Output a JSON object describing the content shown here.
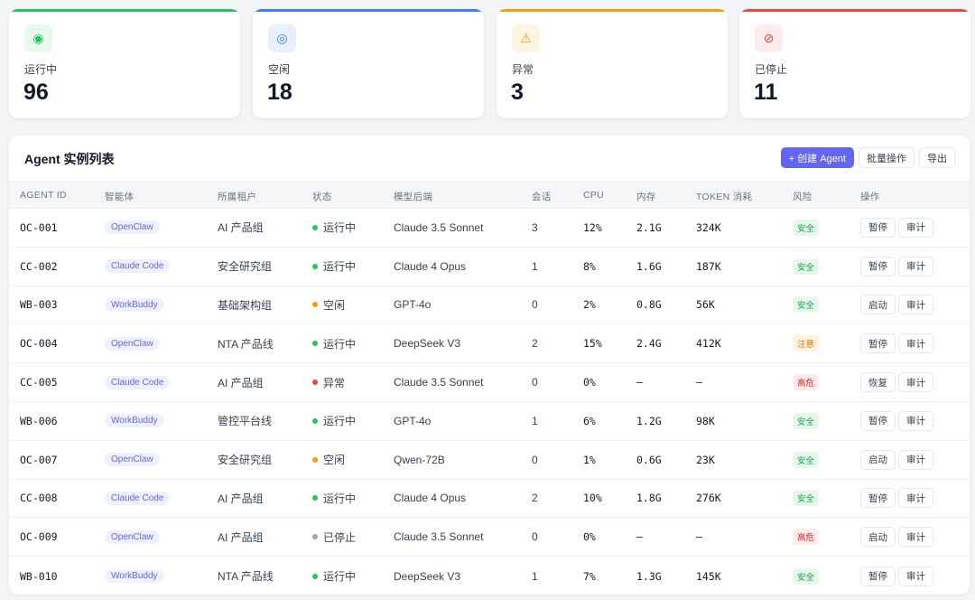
{
  "stats": [
    {
      "label": "运行中",
      "value": "96",
      "icon": "running-icon",
      "glyph": "◉",
      "color": "#22c55e",
      "icon_bg": "#e8f8ee"
    },
    {
      "label": "空闲",
      "value": "18",
      "icon": "idle-icon",
      "glyph": "◎",
      "color": "#3b82f6",
      "icon_bg": "#e9f0fd"
    },
    {
      "label": "异常",
      "value": "3",
      "icon": "warning-icon",
      "glyph": "⚠",
      "color": "#f59e0b",
      "icon_bg": "#fdf5e3"
    },
    {
      "label": "已停止",
      "value": "11",
      "icon": "stopped-icon",
      "glyph": "⊘",
      "color": "#ef4444",
      "icon_bg": "#fdeceb"
    }
  ],
  "panel": {
    "title": "Agent 实例列表",
    "create_label": "+ 创建 Agent",
    "batch_label": "批量操作",
    "export_label": "导出"
  },
  "table": {
    "headers": [
      "AGENT ID",
      "智能体",
      "所属租户",
      "状态",
      "模型后端",
      "会话",
      "CPU",
      "内存",
      "TOKEN 消耗",
      "风险",
      "操作"
    ],
    "rows": [
      {
        "id": "OC-001",
        "agent": "OpenClaw",
        "tenant": "AI 产品组",
        "status": "运行中",
        "status_color": "#22c55e",
        "model": "Claude 3.5 Sonnet",
        "sessions": "3",
        "cpu": "12%",
        "mem": "2.1G",
        "tokens": "324K",
        "risk": "安全",
        "action": "暂停",
        "audit": "审计"
      },
      {
        "id": "CC-002",
        "agent": "Claude Code",
        "tenant": "安全研究组",
        "status": "运行中",
        "status_color": "#22c55e",
        "model": "Claude 4 Opus",
        "sessions": "1",
        "cpu": "8%",
        "mem": "1.6G",
        "tokens": "187K",
        "risk": "安全",
        "action": "暂停",
        "audit": "审计"
      },
      {
        "id": "WB-003",
        "agent": "WorkBuddy",
        "tenant": "基础架构组",
        "status": "空闲",
        "status_color": "#f59e0b",
        "model": "GPT-4o",
        "sessions": "0",
        "cpu": "2%",
        "mem": "0.8G",
        "tokens": "56K",
        "risk": "安全",
        "action": "启动",
        "audit": "审计"
      },
      {
        "id": "OC-004",
        "agent": "OpenClaw",
        "tenant": "NTA 产品线",
        "status": "运行中",
        "status_color": "#22c55e",
        "model": "DeepSeek V3",
        "sessions": "2",
        "cpu": "15%",
        "mem": "2.4G",
        "tokens": "412K",
        "risk": "注意",
        "action": "暂停",
        "audit": "审计"
      },
      {
        "id": "CC-005",
        "agent": "Claude Code",
        "tenant": "AI 产品组",
        "status": "异常",
        "status_color": "#ef4444",
        "model": "Claude 3.5 Sonnet",
        "sessions": "0",
        "cpu": "0%",
        "mem": "—",
        "tokens": "—",
        "risk": "高危",
        "action": "恢复",
        "audit": "审计"
      },
      {
        "id": "WB-006",
        "agent": "WorkBuddy",
        "tenant": "管控平台线",
        "status": "运行中",
        "status_color": "#22c55e",
        "model": "GPT-4o",
        "sessions": "1",
        "cpu": "6%",
        "mem": "1.2G",
        "tokens": "98K",
        "risk": "安全",
        "action": "暂停",
        "audit": "审计"
      },
      {
        "id": "OC-007",
        "agent": "OpenClaw",
        "tenant": "安全研究组",
        "status": "空闲",
        "status_color": "#f59e0b",
        "model": "Qwen-72B",
        "sessions": "0",
        "cpu": "1%",
        "mem": "0.6G",
        "tokens": "23K",
        "risk": "安全",
        "action": "启动",
        "audit": "审计"
      },
      {
        "id": "CC-008",
        "agent": "Claude Code",
        "tenant": "AI 产品组",
        "status": "运行中",
        "status_color": "#22c55e",
        "model": "Claude 4 Opus",
        "sessions": "2",
        "cpu": "10%",
        "mem": "1.8G",
        "tokens": "276K",
        "risk": "安全",
        "action": "暂停",
        "audit": "审计"
      },
      {
        "id": "OC-009",
        "agent": "OpenClaw",
        "tenant": "AI 产品组",
        "status": "已停止",
        "status_color": "#9ca3af",
        "model": "Claude 3.5 Sonnet",
        "sessions": "0",
        "cpu": "0%",
        "mem": "—",
        "tokens": "—",
        "risk": "高危",
        "action": "启动",
        "audit": "审计"
      },
      {
        "id": "WB-010",
        "agent": "WorkBuddy",
        "tenant": "NTA 产品线",
        "status": "运行中",
        "status_color": "#22c55e",
        "model": "DeepSeek V3",
        "sessions": "1",
        "cpu": "7%",
        "mem": "1.3G",
        "tokens": "145K",
        "risk": "安全",
        "action": "暂停",
        "audit": "审计"
      }
    ]
  },
  "risk_colors": {
    "安全": {
      "fg": "#16a34a",
      "bg": "#e7f7ec"
    },
    "注意": {
      "fg": "#d97706",
      "bg": "#fdf3e1"
    },
    "高危": {
      "fg": "#dc2626",
      "bg": "#fdeaea"
    }
  }
}
